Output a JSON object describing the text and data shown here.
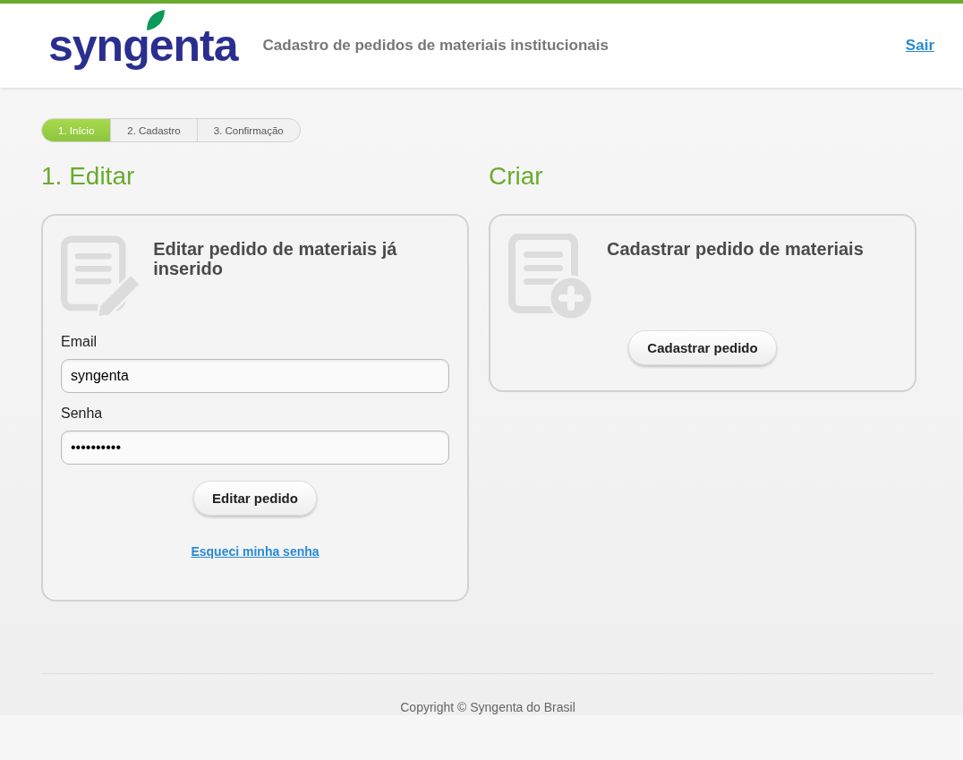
{
  "header": {
    "logo": "syngenta",
    "title": "Cadastro de pedidos de materiais institucionais",
    "logout": "Sair"
  },
  "steps": [
    {
      "label": "1. Início",
      "selected": true
    },
    {
      "label": "2. Cadastro",
      "selected": false
    },
    {
      "label": "3. Confirmação",
      "selected": false
    }
  ],
  "columns": [
    {
      "kind": "edit",
      "heading": "1. Editar",
      "card_title": "Editar pedido de materiais já inserido",
      "fields": [
        {
          "label": "Email",
          "value": "syngenta"
        },
        {
          "label": "Senha",
          "value": "••••••••••"
        }
      ],
      "button": "Editar pedido",
      "link": "Esqueci minha senha"
    },
    {
      "kind": "create",
      "heading": "Criar",
      "card_title": "Cadastrar pedido de materiais",
      "button": "Cadastrar pedido"
    }
  ],
  "footer": {
    "copyright": "Copyright © Syngenta do Brasil"
  }
}
